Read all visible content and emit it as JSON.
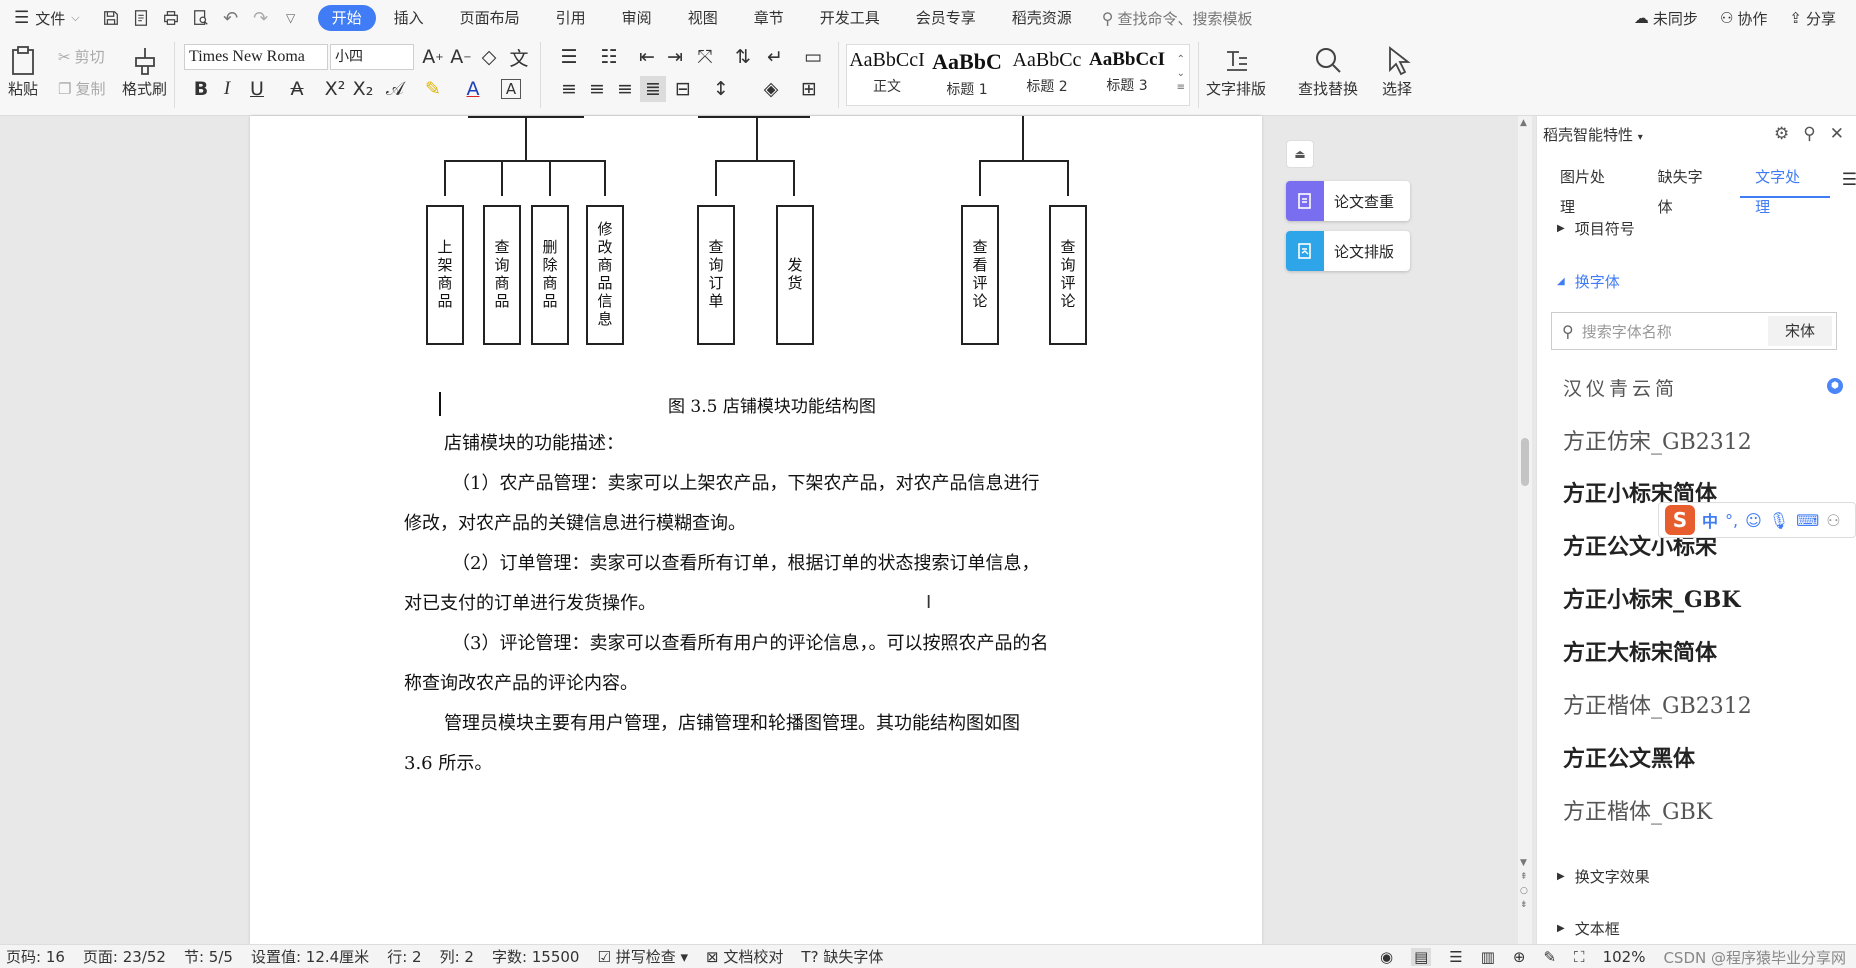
{
  "menubar": {
    "file_label": "文件",
    "tabs": [
      "开始",
      "插入",
      "页面布局",
      "引用",
      "审阅",
      "视图",
      "章节",
      "开发工具",
      "会员专享",
      "稻壳资源"
    ],
    "search_placeholder": "查找命令、搜索模板",
    "sync_label": "未同步",
    "collab_label": "协作",
    "share_label": "分享"
  },
  "ribbon": {
    "paste": "粘贴",
    "cut": "剪切",
    "copy": "复制",
    "format_painter": "格式刷",
    "font_name": "Times New Roma",
    "font_size": "小四",
    "styles": [
      {
        "sample": "AaBbCcI",
        "name": "正文"
      },
      {
        "sample": "AaBbC",
        "name": "标题 1"
      },
      {
        "sample": "AaBbCc",
        "name": "标题 2"
      },
      {
        "sample": "AaBbCcI",
        "name": "标题 3"
      }
    ],
    "text_layout": "文字排版",
    "find_replace": "查找替换",
    "select": "选择"
  },
  "diagram": {
    "boxes": [
      "上架商品",
      "查询商品",
      "删除商品",
      "修改商品信息",
      "查询订单",
      "发货",
      "查看评论",
      "查询评论"
    ],
    "caption": "图 3.5  店铺模块功能结构图"
  },
  "document": {
    "paragraphs": [
      "店铺模块的功能描述：",
      "（1）农产品管理：卖家可以上架农产品，下架农产品，对农产品信息进行",
      "修改，对农产品的关键信息进行模糊查询。",
      "（2）订单管理：卖家可以查看所有订单，根据订单的状态搜索订单信息，",
      "对已支付的订单进行发货操作。",
      "（3）评论管理：卖家可以查看所有用户的评论信息，。可以按照农产品的名",
      "称查询改农产品的评论内容。",
      "管理员模块主要有用户管理，店铺管理和轮播图管理。其功能结构图如图",
      "3.6 所示。"
    ]
  },
  "paper_tools": {
    "check": "论文查重",
    "layout": "论文排版"
  },
  "panel": {
    "title": "稻壳智能特性",
    "tabs": [
      "图片处理",
      "缺失字体",
      "文字处理"
    ],
    "sections": {
      "bullets": "项目符号",
      "change_font": "换字体",
      "font_effects": "换文字效果",
      "textbox": "文本框"
    },
    "font_search_placeholder": "搜索字体名称",
    "current_font": "宋体",
    "fonts": [
      "汉仪青云简",
      "方正仿宋_GB2312",
      "方正小标宋简体",
      "方正公文小标宋",
      "方正小标宋_GBK",
      "方正大标宋简体",
      "方正楷体_GB2312",
      "方正公文黑体",
      "方正楷体_GBK"
    ]
  },
  "ime": {
    "mode": "中"
  },
  "status": {
    "page_code": "页码: 16",
    "pages": "页面: 23/52",
    "section": "节: 5/5",
    "setting": "设置值: 12.4厘米",
    "row": "行: 2",
    "col": "列: 2",
    "words": "字数: 15500",
    "spell": "拼写检查",
    "proof": "文档校对",
    "missing_font": "缺失字体",
    "zoom": "102%",
    "watermark": "CSDN @程序猿毕业分享网"
  },
  "colors": {
    "accent": "#3f7cf5"
  }
}
